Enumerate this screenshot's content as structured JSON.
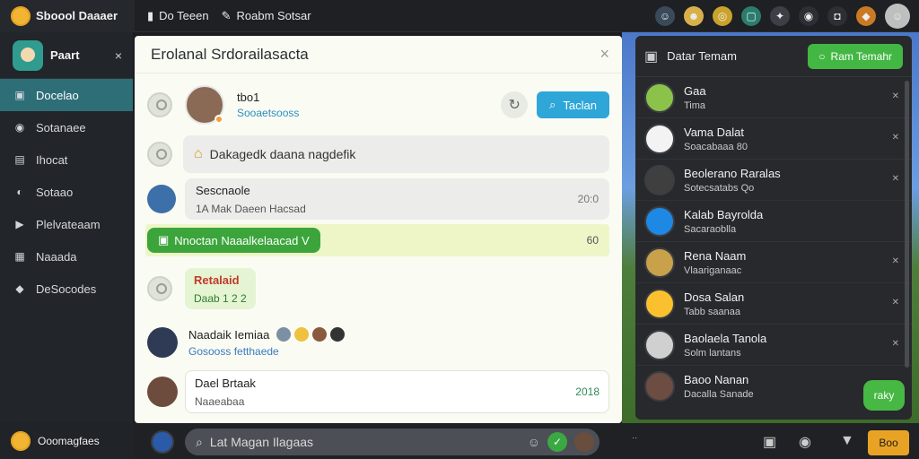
{
  "app": {
    "title": "Sboool Daaaer"
  },
  "topbar": {
    "item1": "Do Teeen",
    "item2": "Roabm Sotsar"
  },
  "sidebar": {
    "profile_name": "Paart",
    "close": "×",
    "items": [
      {
        "label": "Docelao",
        "icon": "▣"
      },
      {
        "label": "Sotanaee",
        "icon": "◉"
      },
      {
        "label": "Ihocat",
        "icon": "▤"
      },
      {
        "label": "Sotaao",
        "icon": "◐"
      },
      {
        "label": "Plelvateaam",
        "icon": "▶"
      },
      {
        "label": "Naaada",
        "icon": "▦"
      },
      {
        "label": "DeSocodes",
        "icon": "◆"
      }
    ],
    "footer": "Ooomagfaes"
  },
  "main": {
    "title": "Erolanal Srdorailasacta",
    "close": "×",
    "row1": {
      "name": "tbo1",
      "sub": "Sooaetsooss",
      "button": "Taclan"
    },
    "row2": {
      "text": "Dakagedk daana nagdefik"
    },
    "row3": {
      "name": "Sescnaole",
      "sub": "1A Mak Daeen Hacsad",
      "time": "20:0"
    },
    "row4": {
      "pill": "Nnoctan Naaalkelaacad V",
      "meta": "60"
    },
    "row5": {
      "name": "Retalaid",
      "sub": "Daab 1 2 2"
    },
    "row6": {
      "name": "Naadaik Iemiaa",
      "sub": "Gosooss fetthaede"
    },
    "row7": {
      "name": "Dael Brtaak",
      "sub": "Naaeabaa",
      "time": "2018"
    }
  },
  "right": {
    "title": "Datar Temam",
    "button": "Ram Temahr",
    "items": [
      {
        "name": "Gaa",
        "sub": "Tima",
        "color": "#8bc34a"
      },
      {
        "name": "Vama Dalat",
        "sub": "Soacabaaa 80",
        "color": "#f3f3f3"
      },
      {
        "name": "Beolerano Raralas",
        "sub": "Sotecsatabs Qo",
        "color": "#3f3f3f"
      },
      {
        "name": "Kalab Bayrolda",
        "sub": "Sacaraoblla",
        "color": "#1e88e5"
      },
      {
        "name": "Rena Naam",
        "sub": "Vlaariganaac",
        "color": "#c8a14a"
      },
      {
        "name": "Dosa Salan",
        "sub": "Tabb saanaa",
        "color": "#fbc02d"
      },
      {
        "name": "Baolaela Tanola",
        "sub": "Solm lantans",
        "color": "#d0d0d0"
      },
      {
        "name": "Baoo Nanan",
        "sub": "Dacalla Sanade",
        "color": "#6d4c41"
      }
    ],
    "fab": "raky"
  },
  "bottom": {
    "placeholder": "Lat Magan Ilagaas",
    "send": "Boo"
  }
}
